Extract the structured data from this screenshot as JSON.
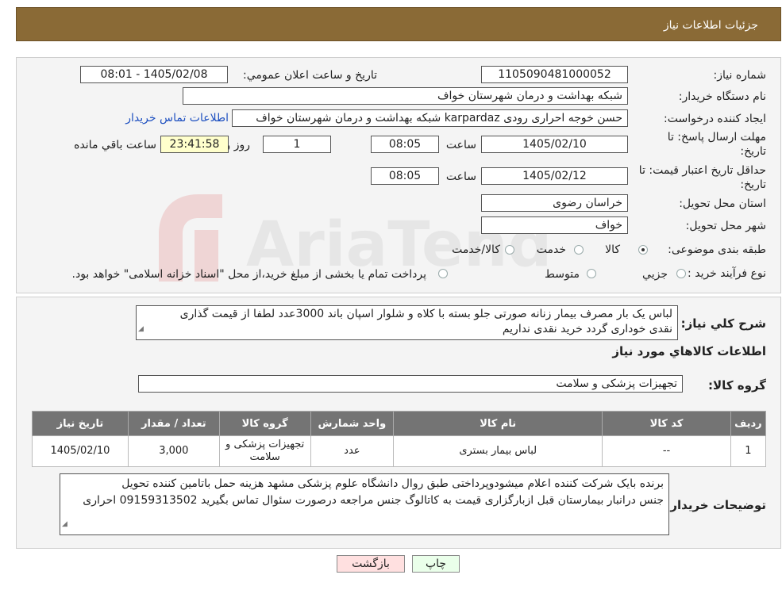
{
  "header": {
    "title": "جزئيات اطلاعات نياز"
  },
  "form": {
    "need_number_label": "شماره نياز:",
    "need_number": "1105090481000052",
    "announce_label": "تاريخ و ساعت اعلان عمومي:",
    "announce_value": "1405/02/08 - 08:01",
    "buyer_org_label": "نام دستگاه خريدار:",
    "buyer_org": "شبکه بهداشت و درمان شهرستان خواف",
    "creator_label": "ايجاد کننده درخواست:",
    "creator": "حسن خوجه احراری رودی karpardaz شبکه بهداشت و درمان شهرستان خواف",
    "contact_link": "اطلاعات تماس خريدار",
    "deadline_label_1": "مهلت ارسال پاسخ: تا",
    "deadline_label_2": "تاريخ:",
    "deadline_date": "1405/02/10",
    "time_label": "ساعت",
    "deadline_time": "08:05",
    "days_value": "1",
    "days_label": "روز و",
    "remaining_time": "23:41:58",
    "remaining_label": "ساعت باقي مانده",
    "validity_label_1": "حداقل تاريخ اعتبار قيمت: تا",
    "validity_label_2": "تاريخ:",
    "validity_date": "1405/02/12",
    "validity_time": "08:05",
    "province_label": "استان محل تحويل:",
    "province": "خراسان رضوی",
    "city_label": "شهر محل تحويل:",
    "city": "خواف",
    "category_label": "طبقه بندی موضوعی:",
    "category_options": [
      "کالا",
      "خدمت",
      "کالا/خدمت"
    ],
    "category_selected": "کالا",
    "process_label": "نوع فرآيند خريد :",
    "process_options": [
      "جزيي",
      "متوسط"
    ],
    "process_note": "پرداخت تمام يا بخشی از مبلغ خريد،از محل \"اسناد خزانه اسلامی\" خواهد بود."
  },
  "description": {
    "label": "شرح کلي نياز:",
    "text_line1": "لباس یک بار مصرف بیمار زنانه صورتی جلو بسته با کلاه و شلوار اسپان باند 3000عدد لطفا از قیمت گذاری",
    "text_line2": "نقدی خوداری گردد خرید نقدی نداریم"
  },
  "goods": {
    "section_title": "اطلاعات کالاهاي مورد نياز",
    "group_label": "گروه کالا:",
    "group_value": "تجهیزات پزشکی و سلامت",
    "table": {
      "headers": [
        "رديف",
        "کد کالا",
        "نام کالا",
        "واحد شمارش",
        "گروه کالا",
        "تعداد / مقدار",
        "تاريخ نياز"
      ],
      "rows": [
        [
          "1",
          "--",
          "لباس بیمار بستری",
          "عدد",
          "تجهیزات پزشکی و سلامت",
          "3,000",
          "1405/02/10"
        ]
      ]
    }
  },
  "buyer_notes": {
    "label": "توضيحات خريدار:",
    "line1": "برنده بایک شرکت کننده اعلام میشودوپرداختی طبق روال دانشگاه علوم پزشکی مشهد هزینه حمل باتامین کننده تحویل",
    "line2": "جنس درانبار بیمارستان قبل ازبارگزاری قیمت به کاتالوگ جنس مراجعه درصورت سئوال تماس بگیرید 09159313502 احراری"
  },
  "buttons": {
    "print": "چاپ",
    "back": "بازگشت"
  },
  "watermark": {
    "text": "AriaTender.neT"
  },
  "colors": {
    "header_bg": "#8a6a36",
    "table_header_bg": "#747474",
    "timer_bg": "#ffffcc",
    "back_bg": "#ffe0e0",
    "print_bg": "#eaffea"
  }
}
